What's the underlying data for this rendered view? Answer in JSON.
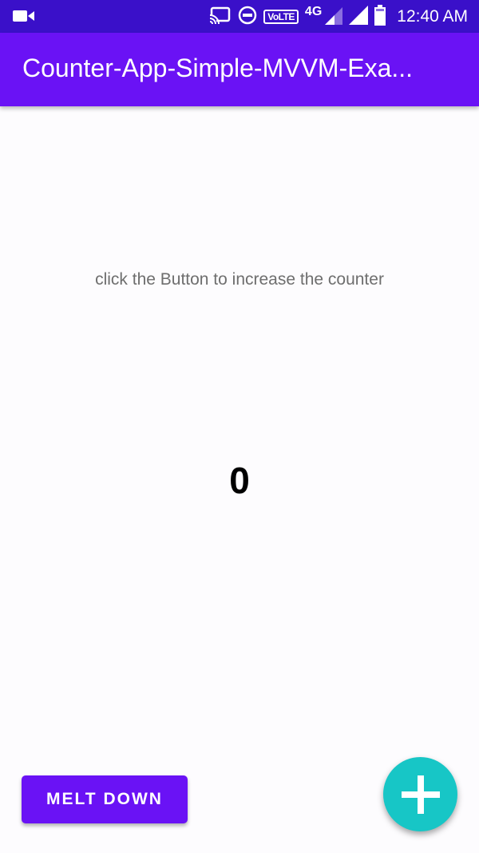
{
  "status_bar": {
    "time": "12:40 AM",
    "volte_label": "VoLTE",
    "network_type": "4G",
    "icons": [
      "video-camera-icon",
      "cast-icon",
      "do-not-disturb-icon",
      "signal-icon",
      "battery-icon"
    ]
  },
  "app_bar": {
    "title": "Counter-App-Simple-MVVM-Exa..."
  },
  "content": {
    "hint": "click the Button to increase the counter",
    "counter_value": "0"
  },
  "actions": {
    "melt_down_label": "MELT DOWN",
    "fab_icon": "add-icon"
  },
  "colors": {
    "status_bar": "#3a10c9",
    "primary": "#6a12f5",
    "fab": "#17c6c6",
    "hint_text": "#6e6e6e"
  }
}
